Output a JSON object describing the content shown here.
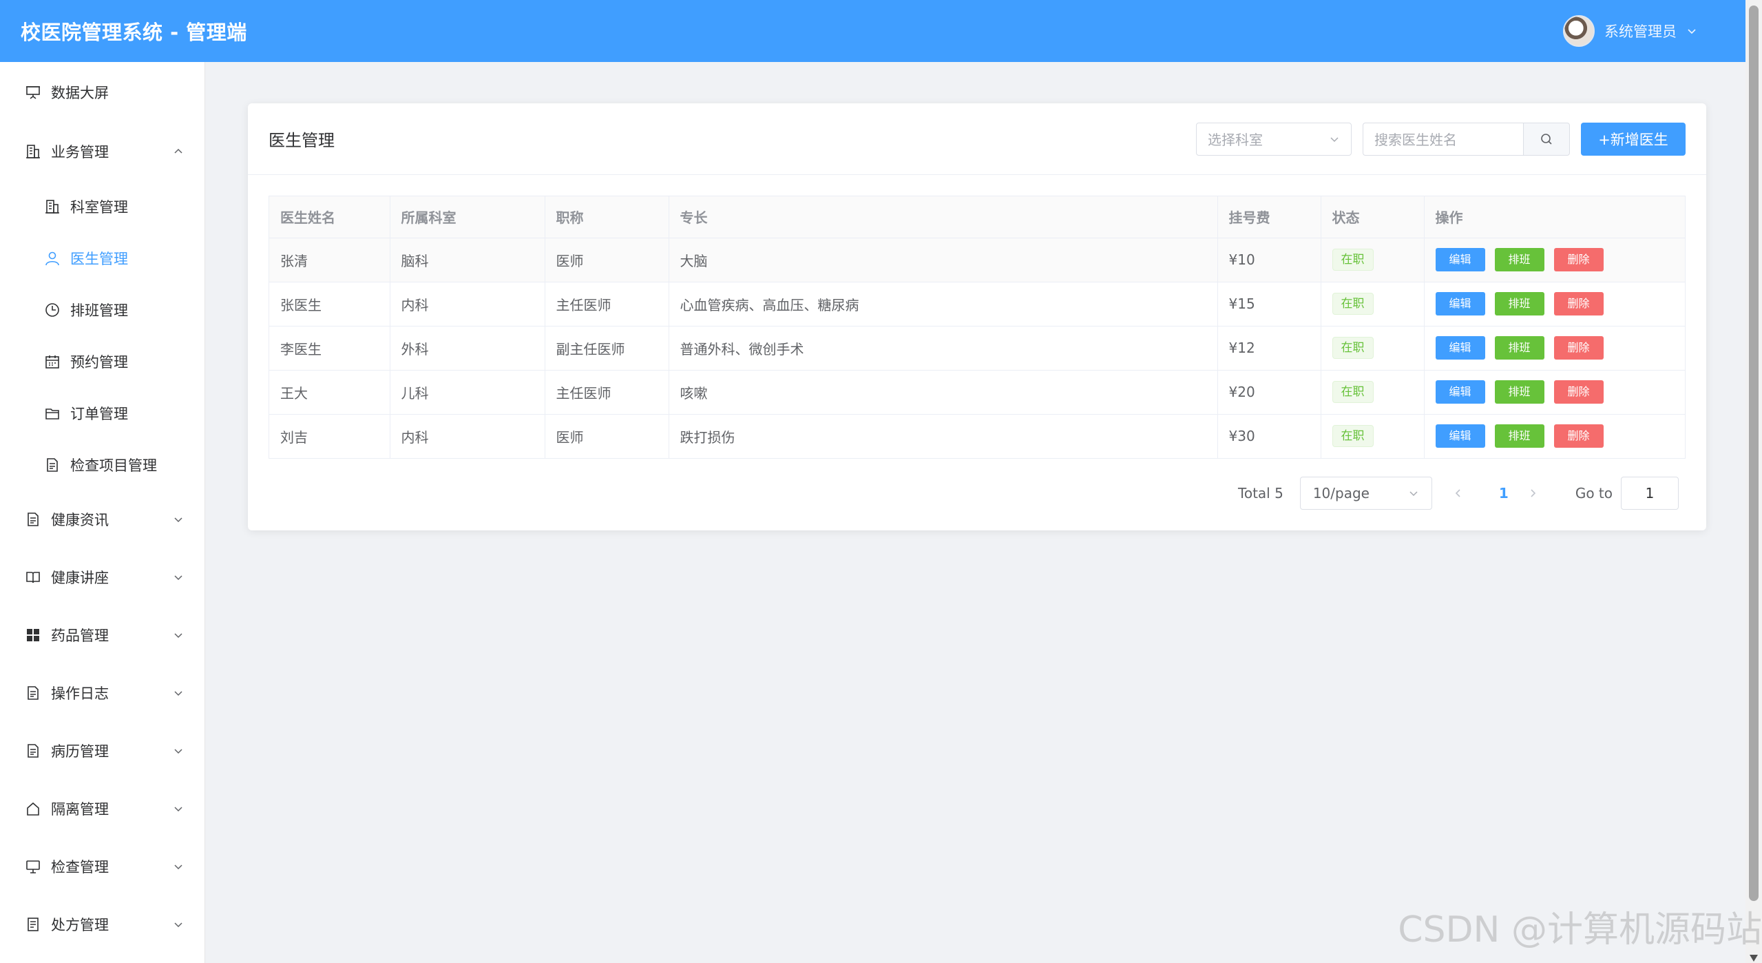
{
  "header": {
    "title": "校医院管理系统 - 管理端",
    "user_name": "系统管理员"
  },
  "sidebar": {
    "items": [
      {
        "label": "数据大屏",
        "icon": "presentation-icon"
      },
      {
        "label": "业务管理",
        "icon": "building-icon",
        "expanded": true
      },
      {
        "label": "健康资讯",
        "icon": "document-icon"
      },
      {
        "label": "健康讲座",
        "icon": "book-icon"
      },
      {
        "label": "药品管理",
        "icon": "grid-icon"
      },
      {
        "label": "操作日志",
        "icon": "document-icon"
      },
      {
        "label": "病历管理",
        "icon": "document-icon"
      },
      {
        "label": "隔离管理",
        "icon": "house-icon"
      },
      {
        "label": "检查管理",
        "icon": "monitor-icon"
      },
      {
        "label": "处方管理",
        "icon": "list-document-icon"
      }
    ],
    "submenu": [
      {
        "label": "科室管理",
        "icon": "building-icon"
      },
      {
        "label": "医生管理",
        "icon": "user-icon",
        "active": true
      },
      {
        "label": "排班管理",
        "icon": "clock-icon"
      },
      {
        "label": "预约管理",
        "icon": "calendar-icon"
      },
      {
        "label": "订单管理",
        "icon": "folder-icon"
      },
      {
        "label": "检查项目管理",
        "icon": "document-icon"
      }
    ]
  },
  "card": {
    "title": "医生管理",
    "dept_select_placeholder": "选择科室",
    "search_placeholder": "搜索医生姓名",
    "add_button": "+新增医生"
  },
  "table": {
    "columns": [
      "医生姓名",
      "所属科室",
      "职称",
      "专长",
      "挂号费",
      "状态",
      "操作"
    ],
    "rows": [
      {
        "name": "张清",
        "dept": "脑科",
        "title": "医师",
        "specialty": "大脑",
        "fee": "¥10",
        "status": "在职"
      },
      {
        "name": "张医生",
        "dept": "内科",
        "title": "主任医师",
        "specialty": "心血管疾病、高血压、糖尿病",
        "fee": "¥15",
        "status": "在职"
      },
      {
        "name": "李医生",
        "dept": "外科",
        "title": "副主任医师",
        "specialty": "普通外科、微创手术",
        "fee": "¥12",
        "status": "在职"
      },
      {
        "name": "王大",
        "dept": "儿科",
        "title": "主任医师",
        "specialty": "咳嗽",
        "fee": "¥20",
        "status": "在职"
      },
      {
        "name": "刘吉",
        "dept": "内科",
        "title": "医师",
        "specialty": "跌打损伤",
        "fee": "¥30",
        "status": "在职"
      }
    ],
    "actions": {
      "edit": "编辑",
      "schedule": "排班",
      "delete": "删除"
    }
  },
  "pagination": {
    "total": "Total 5",
    "page_size": "10/page",
    "current_page": "1",
    "goto_label": "Go to",
    "goto_value": "1"
  },
  "watermark": "CSDN @计算机源码站",
  "colors": {
    "primary": "#409eff",
    "success": "#67c23a",
    "danger": "#f56c6c"
  }
}
